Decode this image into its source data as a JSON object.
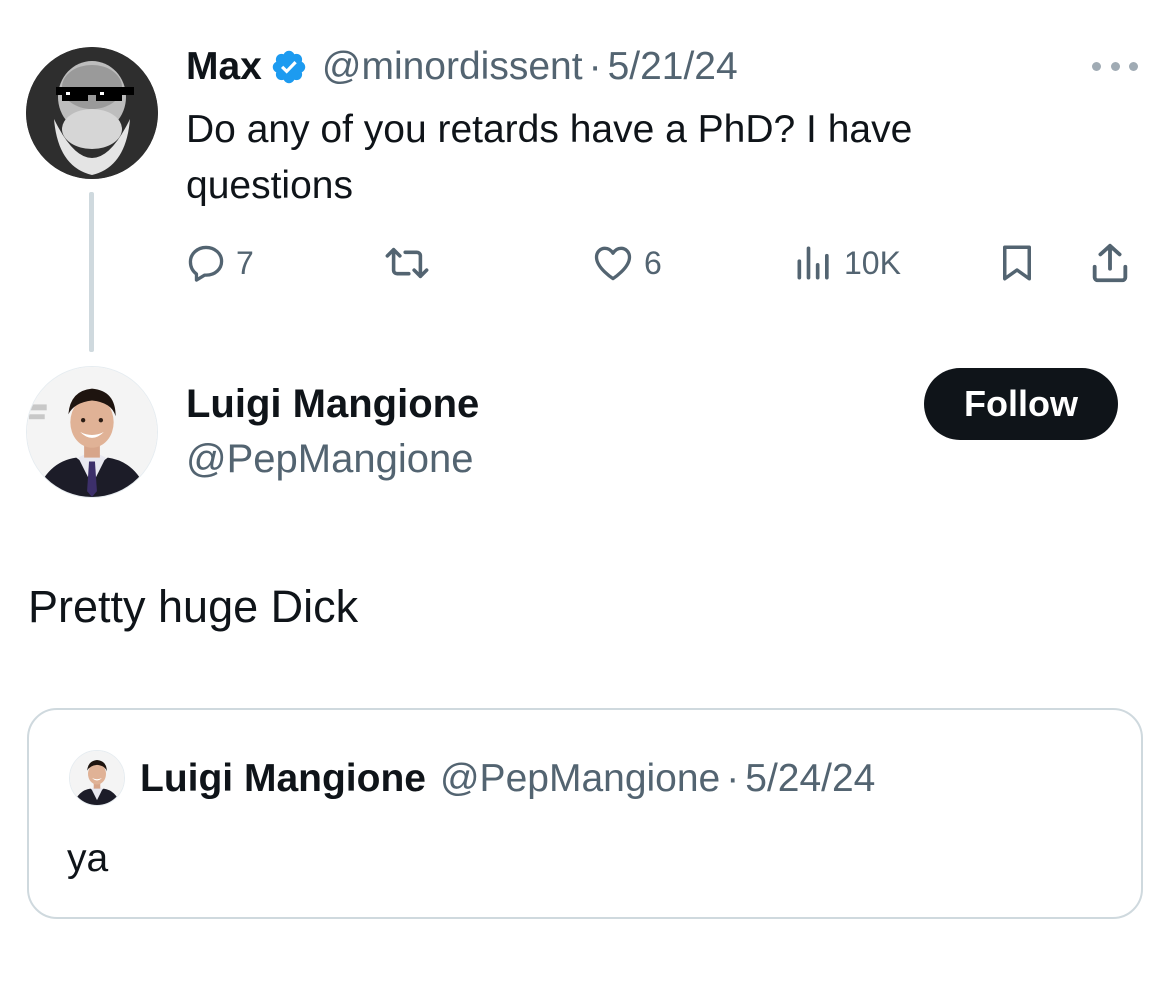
{
  "parent_tweet": {
    "author_name": "Max",
    "verified": true,
    "handle": "@minordissent",
    "separator": "·",
    "date": "5/21/24",
    "text": "Do any of you retards have a PhD? I have questions",
    "actions": {
      "reply_count": "7",
      "retweet_count": "",
      "like_count": "6",
      "view_count": "10K"
    }
  },
  "reply": {
    "author_name": "Luigi Mangione",
    "handle": "@PepMangione",
    "follow_label": "Follow",
    "text": "Pretty huge Dick"
  },
  "quoted_tweet": {
    "author_name": "Luigi Mangione",
    "handle": "@PepMangione",
    "separator": "·",
    "date": "5/24/24",
    "text": "ya"
  },
  "colors": {
    "text_primary": "#0f1419",
    "text_secondary": "#536471",
    "verified_blue": "#1d9bf0",
    "border": "#cfd9de",
    "button_dark": "#0f1419"
  },
  "icons": [
    "more-icon",
    "verified-badge-icon",
    "reply-icon",
    "retweet-icon",
    "like-icon",
    "views-icon",
    "bookmark-icon",
    "share-icon"
  ]
}
